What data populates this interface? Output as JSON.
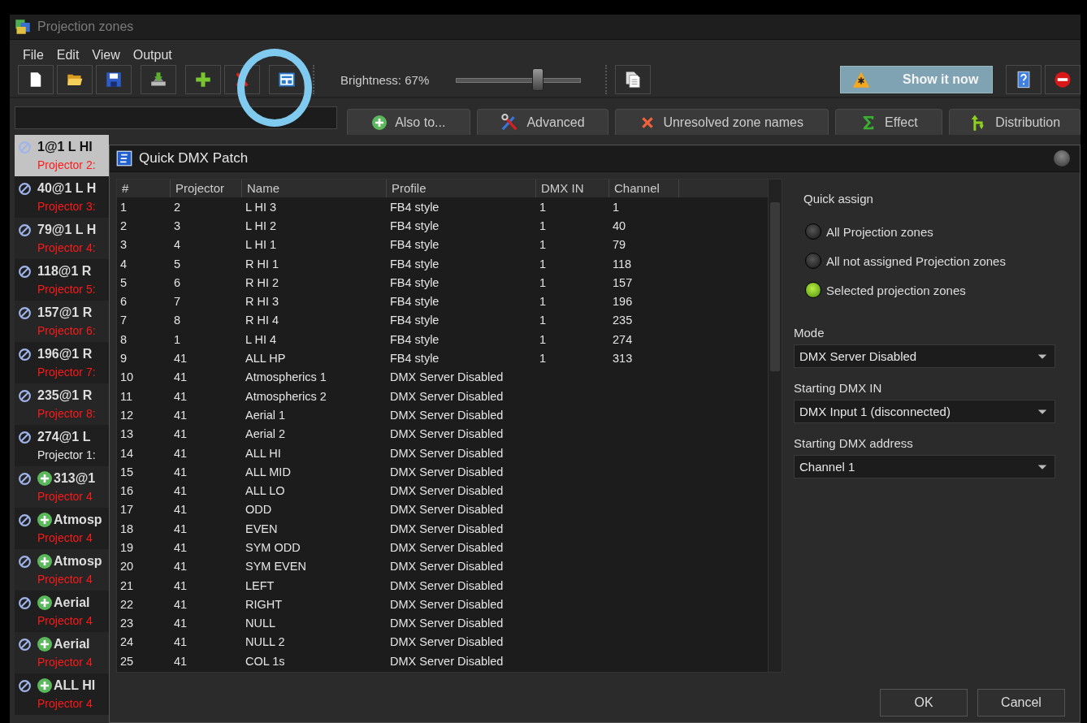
{
  "window": {
    "title": "Projection zones"
  },
  "menu": [
    "File",
    "Edit",
    "View",
    "Output"
  ],
  "toolbar": {
    "brightness": {
      "label": "Brightness: 67%",
      "level": 0.65
    },
    "show_button": "Show it now"
  },
  "action_buttons": [
    {
      "label": "Also to...",
      "kind": "add"
    },
    {
      "label": "Advanced",
      "kind": "tools"
    },
    {
      "label": "Unresolved zone names",
      "kind": "error"
    },
    {
      "label": "Effect",
      "kind": "sum"
    },
    {
      "label": "Distribution",
      "kind": "distribute"
    }
  ],
  "zones": [
    {
      "name": "1@1 L HI",
      "detail": "Projector 2:",
      "warning": true,
      "added": false,
      "selected": true
    },
    {
      "name": "40@1 L H",
      "detail": "Projector 3:",
      "warning": true,
      "added": false,
      "selected": false
    },
    {
      "name": "79@1 L H",
      "detail": "Projector 4:",
      "warning": true,
      "added": false,
      "selected": false
    },
    {
      "name": "118@1 R",
      "detail": "Projector 5:",
      "warning": true,
      "added": false,
      "selected": false
    },
    {
      "name": "157@1 R",
      "detail": "Projector 6:",
      "warning": true,
      "added": false,
      "selected": false
    },
    {
      "name": "196@1 R",
      "detail": "Projector 7:",
      "warning": true,
      "added": false,
      "selected": false
    },
    {
      "name": "235@1 R",
      "detail": "Projector 8:",
      "warning": true,
      "added": false,
      "selected": false
    },
    {
      "name": "274@1 L",
      "detail": "Projector 1:",
      "warning": false,
      "added": false,
      "selected": false
    },
    {
      "name": "313@1",
      "detail": "Projector 4",
      "warning": true,
      "added": true,
      "selected": false
    },
    {
      "name": "Atmosp",
      "detail": "Projector 4",
      "warning": true,
      "added": true,
      "selected": false
    },
    {
      "name": "Atmosp",
      "detail": "Projector 4",
      "warning": true,
      "added": true,
      "selected": false
    },
    {
      "name": "Aerial",
      "detail": "Projector 4",
      "warning": true,
      "added": true,
      "selected": false
    },
    {
      "name": "Aerial",
      "detail": "Projector 4",
      "warning": true,
      "added": true,
      "selected": false
    },
    {
      "name": "ALL HI",
      "detail": "Projector 4",
      "warning": true,
      "added": true,
      "selected": false
    }
  ],
  "dialog": {
    "title": "Quick DMX Patch",
    "table": {
      "columns": [
        "#",
        "Projector",
        "Name",
        "Profile",
        "DMX IN",
        "Channel"
      ],
      "rows": [
        [
          "1",
          "2",
          "L HI 3",
          "FB4 style",
          "1",
          "1"
        ],
        [
          "2",
          "3",
          "L HI 2",
          "FB4 style",
          "1",
          "40"
        ],
        [
          "3",
          "4",
          "L HI 1",
          "FB4 style",
          "1",
          "79"
        ],
        [
          "4",
          "5",
          "R HI 1",
          "FB4 style",
          "1",
          "118"
        ],
        [
          "5",
          "6",
          "R HI 2",
          "FB4 style",
          "1",
          "157"
        ],
        [
          "6",
          "7",
          "R HI 3",
          "FB4 style",
          "1",
          "196"
        ],
        [
          "7",
          "8",
          "R HI 4",
          "FB4 style",
          "1",
          "235"
        ],
        [
          "8",
          "1",
          "L HI 4",
          "FB4 style",
          "1",
          "274"
        ],
        [
          "9",
          "41",
          "ALL HP",
          "FB4 style",
          "1",
          "313"
        ],
        [
          "10",
          "41",
          "Atmospherics 1",
          "DMX Server Disabled"
        ],
        [
          "11",
          "41",
          "Atmospherics 2",
          "DMX Server Disabled"
        ],
        [
          "12",
          "41",
          "Aerial 1",
          "DMX Server Disabled"
        ],
        [
          "13",
          "41",
          "Aerial 2",
          "DMX Server Disabled"
        ],
        [
          "14",
          "41",
          "ALL HI",
          "DMX Server Disabled"
        ],
        [
          "15",
          "41",
          "ALL MID",
          "DMX Server Disabled"
        ],
        [
          "16",
          "41",
          "ALL LO",
          "DMX Server Disabled"
        ],
        [
          "17",
          "41",
          "ODD",
          "DMX Server Disabled"
        ],
        [
          "18",
          "41",
          "EVEN",
          "DMX Server Disabled"
        ],
        [
          "19",
          "41",
          "SYM ODD",
          "DMX Server Disabled"
        ],
        [
          "20",
          "41",
          "SYM EVEN",
          "DMX Server Disabled"
        ],
        [
          "21",
          "41",
          "LEFT",
          "DMX Server Disabled"
        ],
        [
          "22",
          "41",
          "RIGHT",
          "DMX Server Disabled"
        ],
        [
          "23",
          "41",
          "NULL",
          "DMX Server Disabled"
        ],
        [
          "24",
          "41",
          "NULL 2",
          "DMX Server Disabled"
        ],
        [
          "25",
          "41",
          "COL 1s",
          "DMX Server Disabled"
        ]
      ]
    },
    "quick_assign": {
      "title": "Quick assign",
      "options": [
        {
          "label": "All Projection zones",
          "selected": false
        },
        {
          "label": "All not assigned Projection zones",
          "selected": false
        },
        {
          "label": "Selected projection zones",
          "selected": true
        }
      ]
    },
    "fields": [
      {
        "label": "Mode",
        "value": "DMX Server Disabled"
      },
      {
        "label": "Starting DMX IN",
        "value": "DMX Input 1 (disconnected)"
      },
      {
        "label": "Starting DMX address",
        "value": "Channel 1"
      }
    ],
    "buttons": [
      "OK",
      "Cancel"
    ]
  }
}
